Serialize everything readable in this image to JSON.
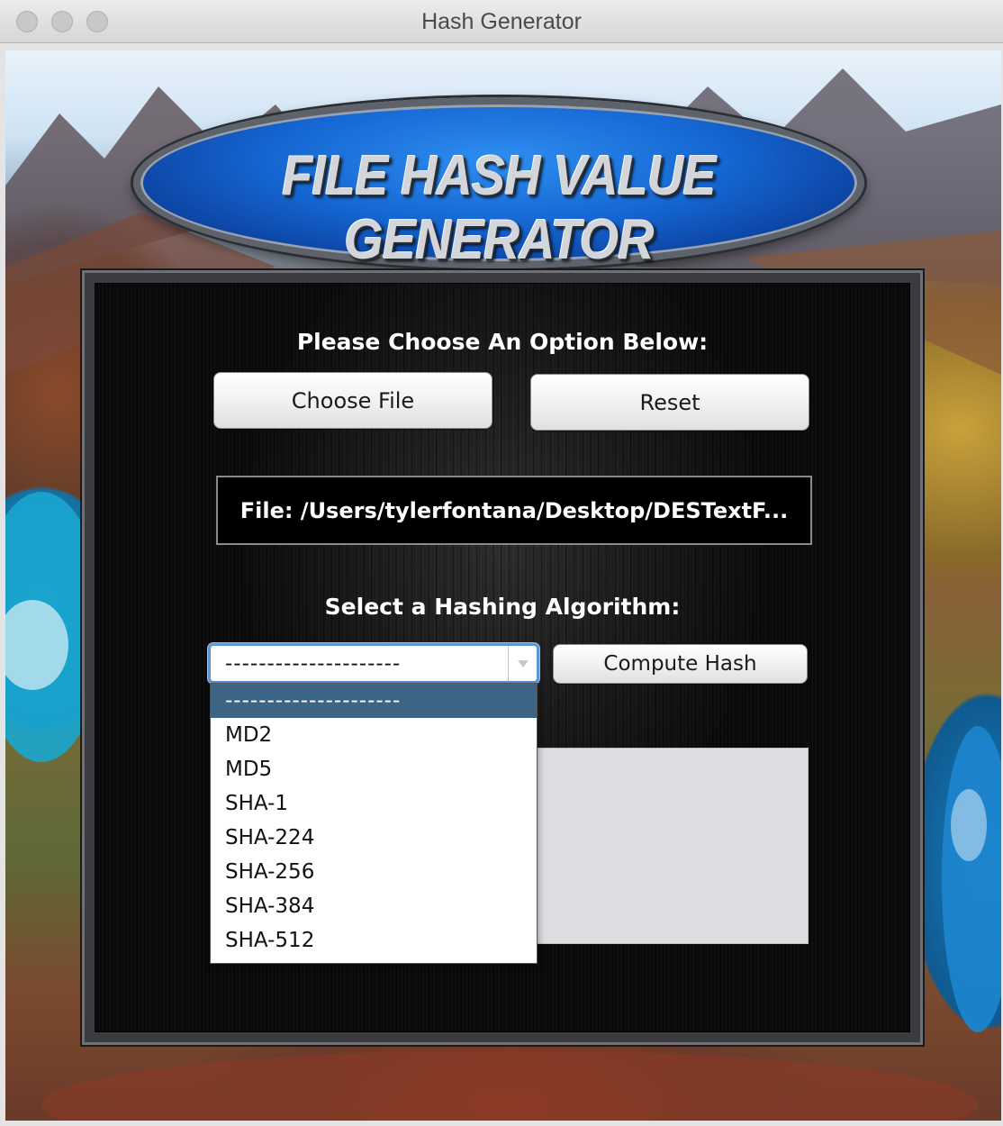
{
  "window": {
    "title": "Hash Generator"
  },
  "logo": {
    "text": "FILE HASH VALUE GENERATOR"
  },
  "panel": {
    "choose_heading": "Please Choose An Option Below:",
    "choose_file_label": "Choose File",
    "reset_label": "Reset",
    "file_path": "File: /Users/tylerfontana/Desktop/DESTextF...",
    "algorithm_heading": "Select a Hashing Algorithm:",
    "compute_label": "Compute Hash",
    "combo_value": "---------------------"
  },
  "dropdown": {
    "options": [
      "---------------------",
      "MD2",
      "MD5",
      "SHA-1",
      "SHA-224",
      "SHA-256",
      "SHA-384",
      "SHA-512"
    ]
  },
  "colors": {
    "selected_option": "#3c6485",
    "focus_ring": "#5e97d8",
    "logo_blue": "#1566d2"
  }
}
